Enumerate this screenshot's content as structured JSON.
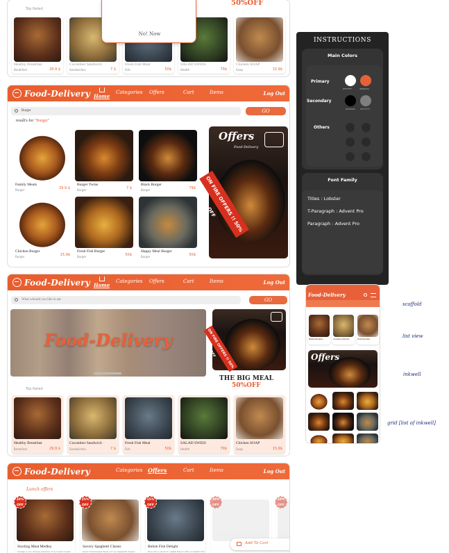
{
  "frame1": {
    "section_title": "Top Rated",
    "popup_button": "No! Now",
    "promo": "50%OFF",
    "items": [
      {
        "name": "Healthy Breakfast",
        "sub": "Breakfast",
        "price": "29.9 $"
      },
      {
        "name": "Cucumber Sandwich",
        "sub": "Sandwiches",
        "price": "7 $"
      },
      {
        "name": "Fresh Fish Meal",
        "sub": "Fish",
        "price": "50$"
      },
      {
        "name": "SALAD SWEIS",
        "sub": "Health",
        "price": "79$"
      },
      {
        "name": "Chicken SOAP",
        "sub": "Soap",
        "price": "15.9$"
      }
    ]
  },
  "brand": {
    "name": "Food-Delivery",
    "accent": "#E8603A"
  },
  "nav": {
    "home": "Home",
    "categories": "Categories",
    "offers": "Offers",
    "cart": "Cart",
    "items": "Items",
    "logout": "Log Out"
  },
  "frame2": {
    "search_value": "Burger",
    "go": "GO",
    "results_prefix": "result's for ",
    "results_term": "\"Burger\"",
    "items": [
      {
        "name": "Family Meals",
        "sub": "Burger",
        "price": "29.9 $"
      },
      {
        "name": "Burger Twins",
        "sub": "Burger",
        "price": "7 $"
      },
      {
        "name": "Black Burger",
        "sub": "Burger",
        "price": "79$"
      },
      {
        "name": "Chicken Burger",
        "sub": "Burger",
        "price": "15.9$"
      },
      {
        "name": "Fresh Fish Burger",
        "sub": "Burger",
        "price": "50$"
      },
      {
        "name": "Happy Meal Burger",
        "sub": "Burger",
        "price": "50$"
      }
    ],
    "offers_title": "Offers",
    "offers_brand": "Food-Delivery",
    "ribbon": "ON FIRE OFFERS !! 50% OFF"
  },
  "frame3": {
    "search_placeholder": "What whould you like to eat",
    "go": "GO",
    "hero_text": "Food-Delivery",
    "ribbon": "ON FIRE OFFERS !! 50% OFF",
    "big_meal": "THE BIG MEAL",
    "big_meal_off": "50%OFF",
    "section_title": "Top Rated",
    "items": [
      {
        "name": "Healthy Breakfast",
        "sub": "Breakfast",
        "price": "29.9 $"
      },
      {
        "name": "Cucumber Sandwich",
        "sub": "Sandwiches",
        "price": "7 $"
      },
      {
        "name": "Fresh Fish Meal",
        "sub": "Fish",
        "price": "50$"
      },
      {
        "name": "SALAD SWEIS",
        "sub": "Health",
        "price": "79$"
      },
      {
        "name": "Chicken SOAP",
        "sub": "Soap",
        "price": "15.9$"
      }
    ]
  },
  "frame4": {
    "section_title": "Lunch offers",
    "add_to_cart": "Add To Cart",
    "items": [
      {
        "badge": "20% OFF",
        "name": "Sizzling Meat Medley",
        "desc": "Indulge in our diverse selection of succulent meats"
      },
      {
        "badge": "25% OFF",
        "name": "Savory Spaghetti Classic",
        "desc": "Savor the timeless flavors of our Spaghetti Classic"
      },
      {
        "badge": "15% OFF",
        "name": "Relish Fish Delight",
        "desc": "Dive into a world of coastal flavors with our Relish Fish"
      },
      {
        "badge": "10% OFF",
        "name": "",
        "desc": ""
      },
      {
        "badge": "10% OFF",
        "name": "",
        "desc": ""
      }
    ]
  },
  "instructions": {
    "title": "INSTRUCTIONS",
    "main_colors": "Main Colors",
    "primary": "Primary",
    "secondary": "Secondary",
    "others": "Others",
    "primary_colors": [
      {
        "hex": "#FFFFFF",
        "label": "#FFFFFF"
      },
      {
        "hex": "#E8603A",
        "label": "#E8603A"
      }
    ],
    "secondary_colors": [
      {
        "hex": "#000000",
        "label": "#000000"
      },
      {
        "hex": "#7F7F7F",
        "label": "#7F7F7F"
      }
    ],
    "font_family": "Font Family",
    "fonts": [
      "Titles : Lobster",
      "T-Paragraph : Advent Pro",
      "Paragraph : Advent Pro"
    ]
  },
  "notes": {
    "scaffold": "scaffold",
    "list_view": "list view",
    "inkwell": "inkwell",
    "grid": "grid [list of inkwell]"
  },
  "phone": {
    "brand": "Food-Delivery",
    "offers": "Offers"
  }
}
